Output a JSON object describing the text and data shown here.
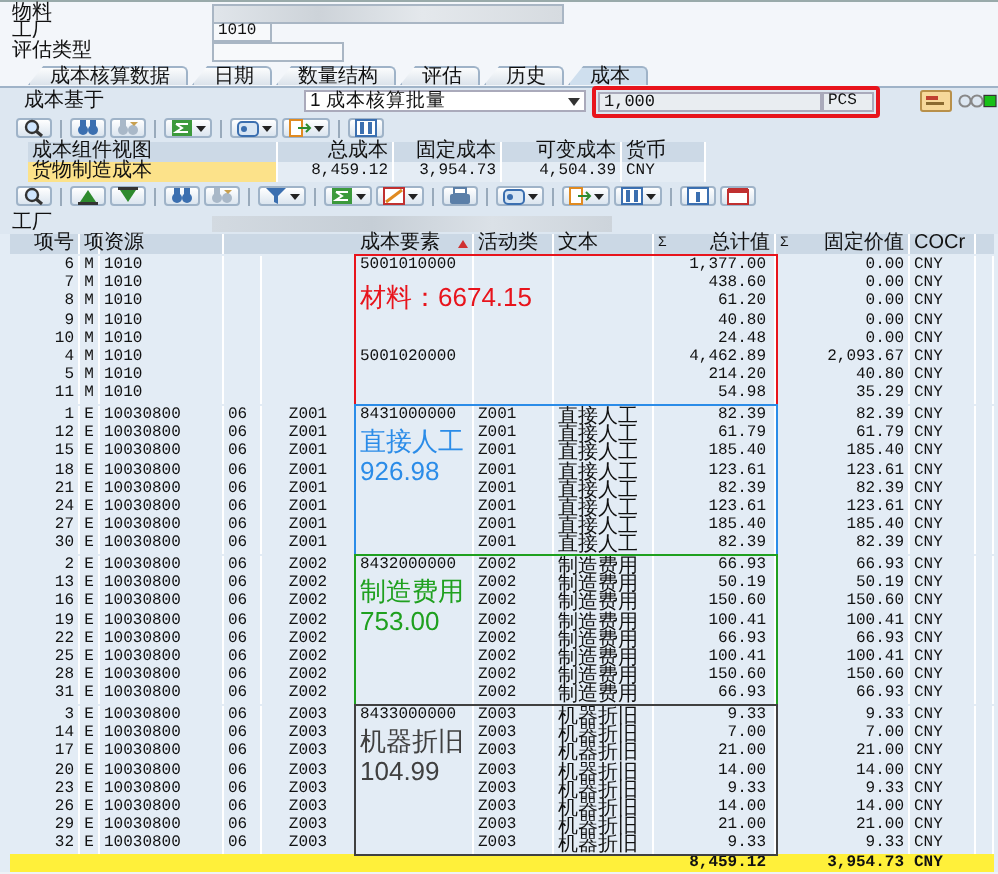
{
  "header_fields": [
    {
      "label": "物料",
      "blurred": true
    },
    {
      "label": "工厂",
      "value": "1010"
    },
    {
      "label": "评估类型"
    }
  ],
  "tabs": [
    {
      "label": "成本核算数据",
      "selected": false
    },
    {
      "label": "日期",
      "selected": false
    },
    {
      "label": "数量结构",
      "selected": false
    },
    {
      "label": "评估",
      "selected": false
    },
    {
      "label": "历史",
      "selected": false
    },
    {
      "label": "成本",
      "selected": true
    }
  ],
  "cost_basis": {
    "label": "成本基于",
    "dropdown": "1 成本核算批量",
    "quantity": "1,000",
    "unit": "PCS",
    "highlighted": true
  },
  "component_view": {
    "columns": [
      "成本组件视图",
      "总成本",
      "固定成本",
      "可变成本",
      "货币"
    ],
    "rows": [
      {
        "cells": [
          "货物制造成本",
          "8,459.12",
          "3,954.73",
          "4,504.39",
          "CNY"
        ],
        "selected": true
      }
    ]
  },
  "filter_field": {
    "label": "工厂",
    "blurred": true
  },
  "table": {
    "headers": {
      "item": "项号",
      "category": "项",
      "resource": "资源",
      "cost_element": "成本要素",
      "activity_type": "活动类",
      "text": "文本",
      "total_value": "总计值",
      "fixed_value": "固定价值",
      "currency": "COCr"
    },
    "total_value_mark": "Σ",
    "fixed_value_mark": "Σ",
    "cost_element_sorted": true,
    "groups": [
      {
        "annotation": {
          "kind": "inline",
          "label": "材料：",
          "value": "6674.15",
          "color": "#e8141c"
        },
        "rows": [
          {
            "item": "6",
            "category": "M",
            "resource": "1010",
            "cost_element": "5001010000",
            "total_value": "1,377.00",
            "fixed_value": "0.00",
            "currency": "CNY"
          },
          {
            "item": "7",
            "category": "M",
            "resource": "1010",
            "total_value": "438.60",
            "fixed_value": "0.00",
            "currency": "CNY"
          },
          {
            "item": "8",
            "category": "M",
            "resource": "1010",
            "total_value": "61.20",
            "fixed_value": "0.00",
            "currency": "CNY"
          },
          {
            "item": "9",
            "category": "M",
            "resource": "1010",
            "total_value": "40.80",
            "fixed_value": "0.00",
            "currency": "CNY"
          },
          {
            "item": "10",
            "category": "M",
            "resource": "1010",
            "total_value": "24.48",
            "fixed_value": "0.00",
            "currency": "CNY"
          },
          {
            "item": "4",
            "category": "M",
            "resource": "1010",
            "cost_element": "5001020000",
            "total_value": "4,462.89",
            "fixed_value": "2,093.67",
            "currency": "CNY"
          },
          {
            "item": "5",
            "category": "M",
            "resource": "1010",
            "total_value": "214.20",
            "fixed_value": "40.80",
            "currency": "CNY"
          },
          {
            "item": "11",
            "category": "M",
            "resource": "1010",
            "total_value": "54.98",
            "fixed_value": "35.29",
            "currency": "CNY"
          }
        ]
      },
      {
        "annotation": {
          "kind": "stacked",
          "label": "直接人工",
          "value": "926.98",
          "color": "#2b8ce8"
        },
        "rows": [
          {
            "item": "1",
            "category": "E",
            "resource": "10030800",
            "column_4": "06",
            "column_5": "Z001",
            "cost_element": "8431000000",
            "activity_type": "Z001",
            "text": "直接人工",
            "total_value": "82.39",
            "fixed_value": "82.39",
            "currency": "CNY"
          },
          {
            "item": "12",
            "category": "E",
            "resource": "10030800",
            "column_4": "06",
            "column_5": "Z001",
            "activity_type": "Z001",
            "text": "直接人工",
            "total_value": "61.79",
            "fixed_value": "61.79",
            "currency": "CNY"
          },
          {
            "item": "15",
            "category": "E",
            "resource": "10030800",
            "column_4": "06",
            "column_5": "Z001",
            "activity_type": "Z001",
            "text": "直接人工",
            "total_value": "185.40",
            "fixed_value": "185.40",
            "currency": "CNY"
          },
          {
            "item": "18",
            "category": "E",
            "resource": "10030800",
            "column_4": "06",
            "column_5": "Z001",
            "activity_type": "Z001",
            "text": "直接人工",
            "total_value": "123.61",
            "fixed_value": "123.61",
            "currency": "CNY"
          },
          {
            "item": "21",
            "category": "E",
            "resource": "10030800",
            "column_4": "06",
            "column_5": "Z001",
            "activity_type": "Z001",
            "text": "直接人工",
            "total_value": "82.39",
            "fixed_value": "82.39",
            "currency": "CNY"
          },
          {
            "item": "24",
            "category": "E",
            "resource": "10030800",
            "column_4": "06",
            "column_5": "Z001",
            "activity_type": "Z001",
            "text": "直接人工",
            "total_value": "123.61",
            "fixed_value": "123.61",
            "currency": "CNY"
          },
          {
            "item": "27",
            "category": "E",
            "resource": "10030800",
            "column_4": "06",
            "column_5": "Z001",
            "activity_type": "Z001",
            "text": "直接人工",
            "total_value": "185.40",
            "fixed_value": "185.40",
            "currency": "CNY"
          },
          {
            "item": "30",
            "category": "E",
            "resource": "10030800",
            "column_4": "06",
            "column_5": "Z001",
            "activity_type": "Z001",
            "text": "直接人工",
            "total_value": "82.39",
            "fixed_value": "82.39",
            "currency": "CNY"
          }
        ]
      },
      {
        "annotation": {
          "kind": "stacked",
          "label": "制造费用",
          "value": "753.00",
          "color": "#1fa01f"
        },
        "rows": [
          {
            "item": "2",
            "category": "E",
            "resource": "10030800",
            "column_4": "06",
            "column_5": "Z002",
            "cost_element": "8432000000",
            "activity_type": "Z002",
            "text": "制造费用",
            "total_value": "66.93",
            "fixed_value": "66.93",
            "currency": "CNY"
          },
          {
            "item": "13",
            "category": "E",
            "resource": "10030800",
            "column_4": "06",
            "column_5": "Z002",
            "activity_type": "Z002",
            "text": "制造费用",
            "total_value": "50.19",
            "fixed_value": "50.19",
            "currency": "CNY"
          },
          {
            "item": "16",
            "category": "E",
            "resource": "10030800",
            "column_4": "06",
            "column_5": "Z002",
            "activity_type": "Z002",
            "text": "制造费用",
            "total_value": "150.60",
            "fixed_value": "150.60",
            "currency": "CNY"
          },
          {
            "item": "19",
            "category": "E",
            "resource": "10030800",
            "column_4": "06",
            "column_5": "Z002",
            "activity_type": "Z002",
            "text": "制造费用",
            "total_value": "100.41",
            "fixed_value": "100.41",
            "currency": "CNY"
          },
          {
            "item": "22",
            "category": "E",
            "resource": "10030800",
            "column_4": "06",
            "column_5": "Z002",
            "activity_type": "Z002",
            "text": "制造费用",
            "total_value": "66.93",
            "fixed_value": "66.93",
            "currency": "CNY"
          },
          {
            "item": "25",
            "category": "E",
            "resource": "10030800",
            "column_4": "06",
            "column_5": "Z002",
            "activity_type": "Z002",
            "text": "制造费用",
            "total_value": "100.41",
            "fixed_value": "100.41",
            "currency": "CNY"
          },
          {
            "item": "28",
            "category": "E",
            "resource": "10030800",
            "column_4": "06",
            "column_5": "Z002",
            "activity_type": "Z002",
            "text": "制造费用",
            "total_value": "150.60",
            "fixed_value": "150.60",
            "currency": "CNY"
          },
          {
            "item": "31",
            "category": "E",
            "resource": "10030800",
            "column_4": "06",
            "column_5": "Z002",
            "activity_type": "Z002",
            "text": "制造费用",
            "total_value": "66.93",
            "fixed_value": "66.93",
            "currency": "CNY"
          }
        ]
      },
      {
        "annotation": {
          "kind": "stacked",
          "label": "机器折旧",
          "value": "104.99",
          "color": "#404040"
        },
        "rows": [
          {
            "item": "3",
            "category": "E",
            "resource": "10030800",
            "column_4": "06",
            "column_5": "Z003",
            "cost_element": "8433000000",
            "activity_type": "Z003",
            "text": "机器折旧",
            "total_value": "9.33",
            "fixed_value": "9.33",
            "currency": "CNY"
          },
          {
            "item": "14",
            "category": "E",
            "resource": "10030800",
            "column_4": "06",
            "column_5": "Z003",
            "activity_type": "Z003",
            "text": "机器折旧",
            "total_value": "7.00",
            "fixed_value": "7.00",
            "currency": "CNY"
          },
          {
            "item": "17",
            "category": "E",
            "resource": "10030800",
            "column_4": "06",
            "column_5": "Z003",
            "activity_type": "Z003",
            "text": "机器折旧",
            "total_value": "21.00",
            "fixed_value": "21.00",
            "currency": "CNY"
          },
          {
            "item": "20",
            "category": "E",
            "resource": "10030800",
            "column_4": "06",
            "column_5": "Z003",
            "activity_type": "Z003",
            "text": "机器折旧",
            "total_value": "14.00",
            "fixed_value": "14.00",
            "currency": "CNY"
          },
          {
            "item": "23",
            "category": "E",
            "resource": "10030800",
            "column_4": "06",
            "column_5": "Z003",
            "activity_type": "Z003",
            "text": "机器折旧",
            "total_value": "9.33",
            "fixed_value": "9.33",
            "currency": "CNY"
          },
          {
            "item": "26",
            "category": "E",
            "resource": "10030800",
            "column_4": "06",
            "column_5": "Z003",
            "activity_type": "Z003",
            "text": "机器折旧",
            "total_value": "14.00",
            "fixed_value": "14.00",
            "currency": "CNY"
          },
          {
            "item": "29",
            "category": "E",
            "resource": "10030800",
            "column_4": "06",
            "column_5": "Z003",
            "activity_type": "Z003",
            "text": "机器折旧",
            "total_value": "21.00",
            "fixed_value": "21.00",
            "currency": "CNY"
          },
          {
            "item": "32",
            "category": "E",
            "resource": "10030800",
            "column_4": "06",
            "column_5": "Z003",
            "activity_type": "Z003",
            "text": "机器折旧",
            "total_value": "9.33",
            "fixed_value": "9.33",
            "currency": "CNY"
          }
        ]
      }
    ],
    "total": {
      "total_value": "8,459.12",
      "fixed_value": "3,954.73",
      "currency": "CNY"
    }
  }
}
